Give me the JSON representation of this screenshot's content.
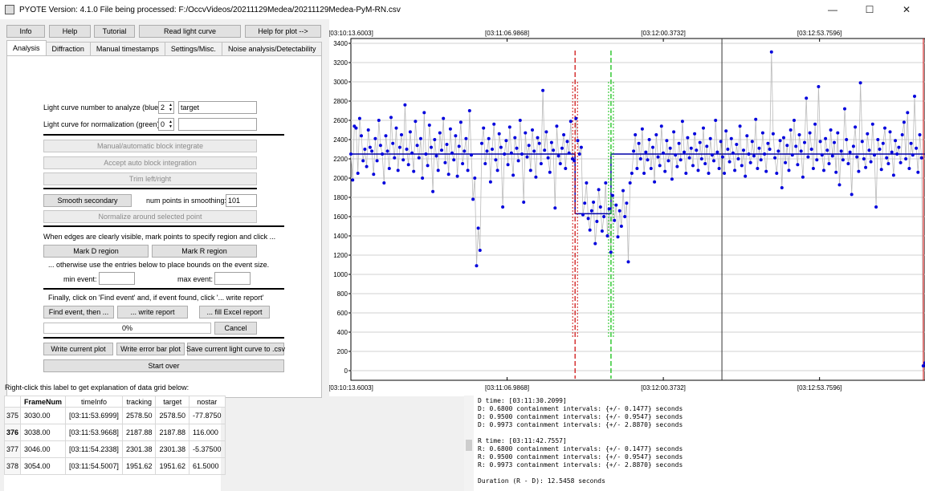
{
  "window": {
    "title": "PYOTE Version: 4.1.0  File being processed: F:/OccvVideos/20211129Medea/20211129Medea-PyM-RN.csv",
    "minimize": "—",
    "maximize": "☐",
    "close": "✕"
  },
  "toolbar": {
    "info": "Info",
    "help": "Help",
    "tutorial": "Tutorial",
    "read_light_curve": "Read light curve",
    "help_for_plot": "Help for plot -->"
  },
  "tabs": [
    "Analysis",
    "Diffraction",
    "Manual timestamps",
    "Settings/Misc.",
    "Noise analysis/Detectability"
  ],
  "analysis": {
    "lc_number_label": "Light curve number to analyze (blue):",
    "lc_number_value": "2",
    "lc_name_value": "target",
    "norm_label": "Light curve for normalization (green):",
    "norm_value": "0",
    "norm_name_value": "",
    "block_integrate": "Manual/automatic block integrate",
    "accept_block": "Accept auto block integration",
    "trim": "Trim left/right",
    "smooth_secondary": "Smooth secondary",
    "num_points_label": "num points in smoothing:",
    "num_points_value": "101",
    "normalize": "Normalize around selected point",
    "edges_label": "When edges are clearly visible, mark points to specify region and click ...",
    "mark_d": "Mark D region",
    "mark_r": "Mark R region",
    "otherwise_label": "... otherwise use the entries below to place bounds on the event size.",
    "min_event_label": "min event:",
    "min_event_value": "",
    "max_event_label": "max event:",
    "max_event_value": "",
    "finally_label": "Finally, click on 'Find event' and, if event found, click '... write report'",
    "find_event": "Find event, then ...",
    "write_report": "... write report",
    "fill_excel": "... fill Excel report",
    "progress_text": "0%",
    "progress_value": 0,
    "cancel": "Cancel",
    "write_plot": "Write current plot",
    "write_error_bar": "Write error bar plot",
    "save_csv": "Save current light curve to .csv",
    "start_over": "Start over"
  },
  "chart_data": {
    "type": "scatter",
    "title": "",
    "xlabel": "",
    "ylabel": "",
    "ylim": [
      -100,
      3450
    ],
    "x_range": [
      0,
      735
    ],
    "yticks": [
      0,
      200,
      400,
      600,
      800,
      1000,
      1200,
      1400,
      1600,
      1800,
      2000,
      2200,
      2400,
      2600,
      2800,
      3000,
      3200,
      3400
    ],
    "time_ticks": [
      {
        "x": 0,
        "label": "[03:10:13.6003]"
      },
      {
        "x": 200,
        "label": "[03:11:06.9868]"
      },
      {
        "x": 400,
        "label": "[03:12:00.3732]"
      },
      {
        "x": 600,
        "label": "[03:12:53.7596]"
      }
    ],
    "grid": true,
    "baseline_level": 2250,
    "event_level": 1630,
    "d_edge_x": 287,
    "r_edge_x": 333,
    "cursor_x": 475,
    "series": [
      {
        "name": "target",
        "color": "#0000dd",
        "line_color": "#bbbbbb",
        "values": [
          2250,
          1980,
          2540,
          2520,
          2050,
          2620,
          2440,
          2180,
          2300,
          2120,
          2500,
          2320,
          2280,
          2040,
          2410,
          2180,
          2600,
          2340,
          2250,
          1950,
          2440,
          2280,
          2100,
          2630,
          2360,
          2210,
          2520,
          2080,
          2320,
          2450,
          2190,
          2760,
          2300,
          2140,
          2480,
          2260,
          2070,
          2590,
          2340,
          2210,
          2410,
          2000,
          2680,
          2250,
          2130,
          2550,
          2320,
          1860,
          2400,
          2230,
          2080,
          2470,
          2290,
          2620,
          2160,
          2350,
          2040,
          2510,
          2260,
          2190,
          2440,
          2020,
          2330,
          2580,
          2150,
          2280,
          2410,
          2080,
          2700,
          2240,
          1780,
          2000,
          1090,
          1480,
          1250,
          2360,
          2520,
          2150,
          2280,
          2410,
          1960,
          2300,
          2560,
          2190,
          2080,
          2460,
          2320,
          1700,
          2250,
          2390,
          2140,
          2530,
          2260,
          2030,
          2420,
          2310,
          2180,
          2600,
          2250,
          1750,
          2470,
          2220,
          2340,
          2080,
          2500,
          2280,
          2010,
          2420,
          2360,
          2150,
          2910,
          2290,
          2480,
          2210,
          2060,
          2370,
          2290,
          1690,
          2540,
          2230,
          2150,
          2310,
          2450,
          2100,
          2380,
          2260,
          2590,
          2200,
          2180,
          2620,
          2390,
          2250,
          2320,
          1620,
          1740,
          1950,
          1580,
          1460,
          1660,
          1750,
          1320,
          1550,
          1880,
          1700,
          1450,
          1600,
          1950,
          1400,
          1680,
          1230,
          1820,
          1560,
          1720,
          1390,
          1660,
          1500,
          1870,
          1600,
          1740,
          1130,
          1950,
          2050,
          2280,
          2450,
          2100,
          2360,
          2200,
          2510,
          2050,
          2270,
          2190,
          2400,
          2100,
          2320,
          1960,
          2450,
          2220,
          2130,
          2540,
          2260,
          2070,
          2390,
          2180,
          2310,
          1990,
          2480,
          2240,
          2120,
          2360,
          2190,
          2590,
          2270,
          2050,
          2420,
          2210,
          2310,
          2130,
          2460,
          2290,
          2080,
          2370,
          2200,
          2520,
          2150,
          2330,
          2050,
          2410,
          2240,
          2180,
          2600,
          2270,
          2100,
          2380,
          2220,
          2050,
          2490,
          2300,
          2170,
          2410,
          2260,
          2080,
          2350,
          2200,
          2540,
          2130,
          2290,
          2020,
          2440,
          2250,
          2160,
          2380,
          2230,
          2610,
          2100,
          2310,
          2190,
          2470,
          2250,
          2070,
          2360,
          2300,
          3310,
          2460,
          2210,
          2050,
          2280,
          2390,
          1900,
          2420,
          2160,
          2340,
          2080,
          2500,
          2240,
          2600,
          2330,
          2140,
          2450,
          2280,
          2010,
          2370,
          2830,
          2220,
          2470,
          2300,
          2100,
          2560,
          2190,
          2950,
          2380,
          2240,
          2080,
          2410,
          2290,
          2150,
          2500,
          2230,
          2370,
          2060,
          2470,
          1930,
          2280,
          2190,
          2720,
          2400,
          2150,
          2270,
          1830,
          2330,
          2530,
          2220,
          2070,
          2990,
          2380,
          2200,
          2110,
          2460,
          2290,
          2170,
          2560,
          2240,
          1700,
          2400,
          2300,
          2090,
          2360,
          2520,
          2210,
          2150,
          2480,
          2270,
          2030,
          2390,
          2250,
          2320,
          2160,
          2450,
          2580,
          2200,
          2680,
          2100,
          2360,
          2240,
          2850,
          2310,
          2060,
          2450,
          2210,
          50,
          80
        ]
      }
    ]
  },
  "plot_labels": {
    "top_time_1": "[03:10:13.6003]",
    "top_time_2": "[03:11:06.9868]",
    "top_time_3": "[03:12:00.3732]",
    "top_time_4": "[03:12:53.7596]"
  },
  "grid_hint": "Right-click this label to get explanation of data grid below:",
  "data_grid": {
    "headers": [
      "FrameNum",
      "timeInfo",
      "tracking",
      "target",
      "nostar"
    ],
    "rows": [
      {
        "row": "375",
        "frame": "3030.00",
        "time": "[03:11:53.6999]",
        "tracking": "2578.50",
        "target": "2578.50",
        "nostar": "-77.8750"
      },
      {
        "row": "376",
        "frame": "3038.00",
        "time": "[03:11:53.9668]",
        "tracking": "2187.88",
        "target": "2187.88",
        "nostar": "116.000"
      },
      {
        "row": "377",
        "frame": "3046.00",
        "time": "[03:11:54.2338]",
        "tracking": "2301.38",
        "target": "2301.38",
        "nostar": "-5.37500"
      },
      {
        "row": "378",
        "frame": "3054.00",
        "time": "[03:11:54.5007]",
        "tracking": "1951.62",
        "target": "1951.62",
        "nostar": "61.5000"
      }
    ]
  },
  "report_lines": [
    "D time: [03:11:30.2099]",
    "D: 0.6800 containment intervals: {+/- 0.1477} seconds",
    "D: 0.9500 containment intervals: {+/- 0.9547} seconds",
    "D: 0.9973 containment intervals: {+/- 2.8870} seconds",
    "",
    "R time: [03:11:42.7557]",
    "R: 0.6800 containment intervals: {+/- 0.1477} seconds",
    "R: 0.9500 containment intervals: {+/- 0.9547} seconds",
    "R: 0.9973 containment intervals: {+/- 2.8870} seconds",
    "",
    "Duration (R - D): 12.5458 seconds"
  ]
}
